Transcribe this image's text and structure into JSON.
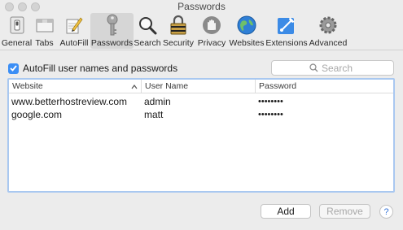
{
  "window": {
    "title": "Passwords"
  },
  "toolbar": {
    "items": [
      {
        "label": "General",
        "icon": "general-icon",
        "selected": false
      },
      {
        "label": "Tabs",
        "icon": "tabs-icon",
        "selected": false
      },
      {
        "label": "AutoFill",
        "icon": "autofill-icon",
        "selected": false
      },
      {
        "label": "Passwords",
        "icon": "key-icon",
        "selected": true
      },
      {
        "label": "Search",
        "icon": "magnifier-icon",
        "selected": false
      },
      {
        "label": "Security",
        "icon": "lock-icon",
        "selected": false
      },
      {
        "label": "Privacy",
        "icon": "hand-icon",
        "selected": false
      },
      {
        "label": "Websites",
        "icon": "globe-icon",
        "selected": false
      },
      {
        "label": "Extensions",
        "icon": "puzzle-icon",
        "selected": false
      },
      {
        "label": "Advanced",
        "icon": "gears-icon",
        "selected": false
      }
    ]
  },
  "autofill": {
    "label": "AutoFill user names and passwords",
    "checked": true
  },
  "search": {
    "placeholder": "Search"
  },
  "table": {
    "headers": {
      "website": "Website",
      "user": "User Name",
      "password": "Password"
    },
    "rows": [
      {
        "website": "www.betterhostreview.com",
        "user": "admin",
        "password": "••••••••"
      },
      {
        "website": "google.com",
        "user": "matt",
        "password": "••••••••"
      }
    ]
  },
  "buttons": {
    "add": "Add",
    "remove": "Remove",
    "help": "?"
  },
  "colors": {
    "accent": "#3b8ef5",
    "selection_border": "#a9c8f0"
  }
}
